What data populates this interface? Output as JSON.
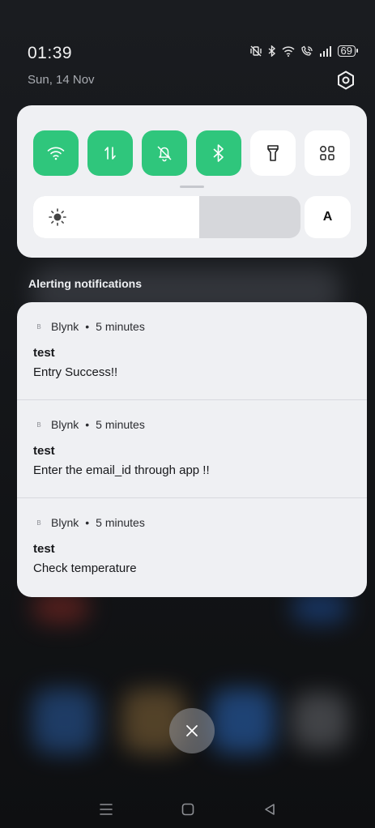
{
  "status_bar": {
    "time": "01:39",
    "date": "Sun, 14 Nov",
    "battery": "69",
    "icons": [
      "vibrate-icon",
      "bluetooth-icon",
      "wifi-icon",
      "wifi-calling-icon",
      "signal-icon",
      "battery-icon"
    ]
  },
  "quick_settings": {
    "tiles": [
      {
        "name": "wifi",
        "icon": "wifi-icon",
        "active": true
      },
      {
        "name": "mobile-data",
        "icon": "mobile-data-icon",
        "active": true
      },
      {
        "name": "silent",
        "icon": "bell-off-icon",
        "active": true
      },
      {
        "name": "bluetooth",
        "icon": "bluetooth-icon",
        "active": true
      },
      {
        "name": "flashlight",
        "icon": "flashlight-icon",
        "active": false
      },
      {
        "name": "edit-tiles",
        "icon": "grid-icon",
        "active": false
      }
    ],
    "brightness_level": 0.62,
    "auto_brightness_label": "A",
    "accent_color": "#2fc67c"
  },
  "notifications": {
    "section_label": "Alerting notifications",
    "items": [
      {
        "app_icon_letter": "B",
        "app": "Blynk",
        "separator": "•",
        "time": "5 minutes",
        "title": "test",
        "body": "Entry Success!!"
      },
      {
        "app_icon_letter": "B",
        "app": "Blynk",
        "separator": "•",
        "time": "5 minutes",
        "title": "test",
        "body": "Enter the email_id through app !!"
      },
      {
        "app_icon_letter": "B",
        "app": "Blynk",
        "separator": "•",
        "time": "5 minutes",
        "title": "test",
        "body": "Check temperature"
      }
    ]
  },
  "navigation": {
    "buttons": [
      "menu-icon",
      "home-icon",
      "back-icon"
    ]
  }
}
